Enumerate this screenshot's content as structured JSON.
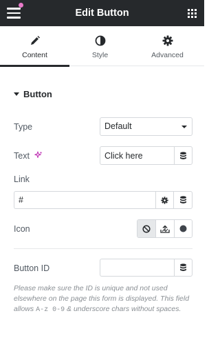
{
  "header": {
    "title": "Edit Button",
    "menu_icon": "hamburger-icon",
    "apps_icon": "grid-icon",
    "notification_color": "#e879c9",
    "background": "#26292c"
  },
  "tabs": [
    {
      "label": "Content",
      "icon": "pencil-icon",
      "active": true
    },
    {
      "label": "Style",
      "icon": "half-circle-icon",
      "active": false
    },
    {
      "label": "Advanced",
      "icon": "gear-icon",
      "active": false
    }
  ],
  "section": {
    "title": "Button",
    "expanded": true
  },
  "fields": {
    "type": {
      "label": "Type",
      "value": "Default"
    },
    "text": {
      "label": "Text",
      "value": "Click here",
      "ai_icon": "sparkle-icon"
    },
    "link": {
      "label": "Link",
      "value": "#"
    },
    "icon": {
      "label": "Icon",
      "options": [
        "none-icon",
        "upload-icon",
        "circle-icon"
      ],
      "selected": "none-icon"
    },
    "button_id": {
      "label": "Button ID",
      "value": "",
      "help_before": "Please make sure the ID is unique and not used elsewhere on the page this form is displayed. This field allows ",
      "help_code": "A-z 0-9",
      "help_after": " & underscore chars without spaces."
    }
  }
}
